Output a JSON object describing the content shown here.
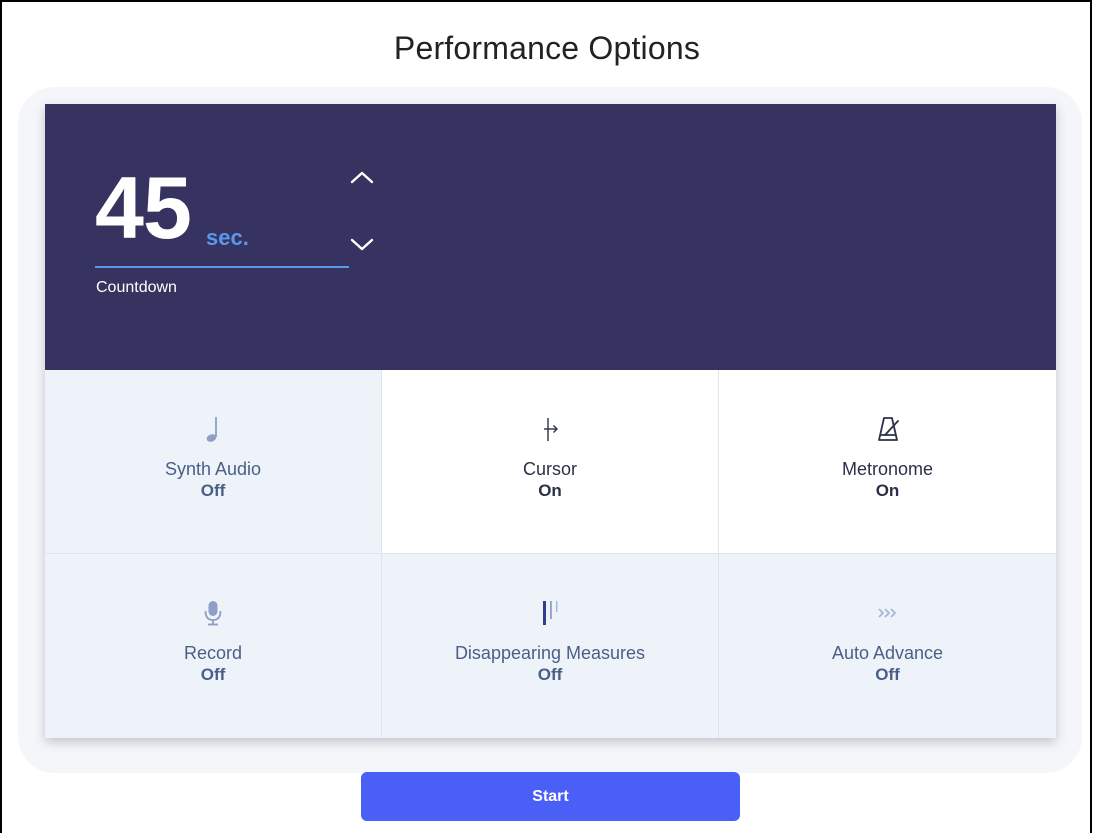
{
  "header": {
    "title": "Performance Options"
  },
  "countdown": {
    "value": "45",
    "unit": "sec.",
    "label": "Countdown"
  },
  "options": [
    {
      "label": "Synth Audio",
      "state": "Off",
      "icon": "music-note-icon"
    },
    {
      "label": "Cursor",
      "state": "On",
      "icon": "cursor-icon"
    },
    {
      "label": "Metronome",
      "state": "On",
      "icon": "metronome-icon"
    },
    {
      "label": "Record",
      "state": "Off",
      "icon": "microphone-icon"
    },
    {
      "label": "Disappearing Measures",
      "state": "Off",
      "icon": "disappearing-measures-icon"
    },
    {
      "label": "Auto Advance",
      "state": "Off",
      "icon": "auto-advance-icon"
    }
  ],
  "start_label": "Start",
  "colors": {
    "hero_bg": "#373360",
    "accent": "#5b98ec",
    "primary_button": "#4a5ff5",
    "off_tile_bg": "#eef3f9"
  }
}
